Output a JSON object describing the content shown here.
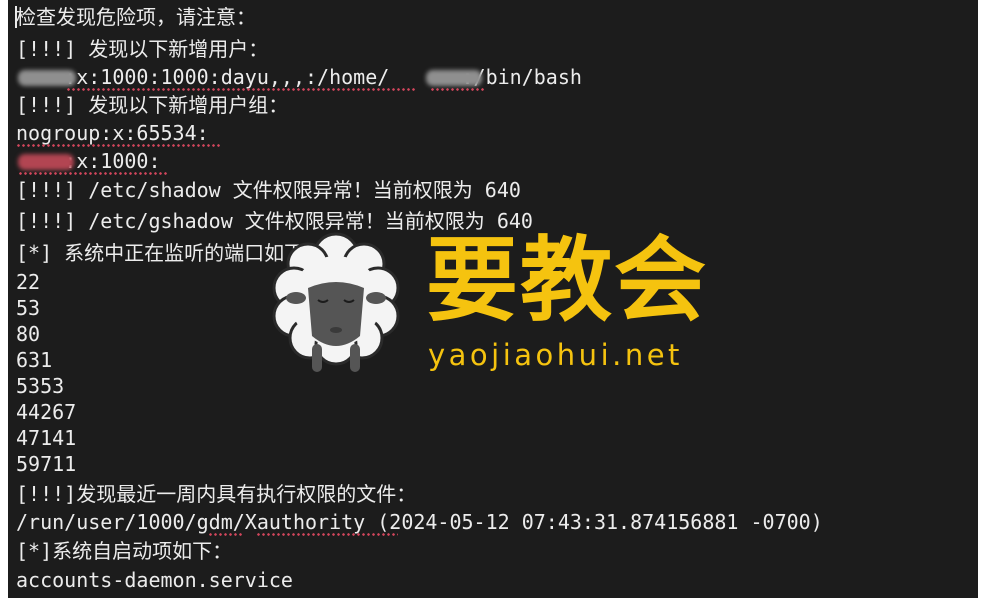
{
  "terminal": {
    "lines": [
      "检查发现危险项，请注意：",
      "[!!!] 发现以下新增用户：",
      "    :x:1000:1000:dayu,,,:/home/      :/bin/bash",
      "[!!!] 发现以下新增用户组：",
      "nogroup:x:65534:",
      "    :x:1000:",
      "[!!!] /etc/shadow 文件权限异常！当前权限为 640",
      "[!!!] /etc/gshadow 文件权限异常！当前权限为 640",
      "[*] 系统中正在监听的端口如下：",
      "22",
      "53",
      "80",
      "631",
      "5353",
      "44267",
      "47141",
      "59711",
      "[!!!]发现最近一周内具有执行权限的文件：",
      "/run/user/1000/gdm/Xauthority (2024-05-12 07:43:31.874156881 -0700)",
      "[*]系统自启动项如下：",
      "accounts-daemon.service"
    ]
  },
  "watermark": {
    "title": "要教会",
    "url": "yaojiaohui.net",
    "icon": "sheep-icon"
  },
  "colors": {
    "terminal_background": "#1c1c1c",
    "text": "#ececec",
    "watermark": "#f5c30f",
    "spellcheck": "#d3465c"
  }
}
